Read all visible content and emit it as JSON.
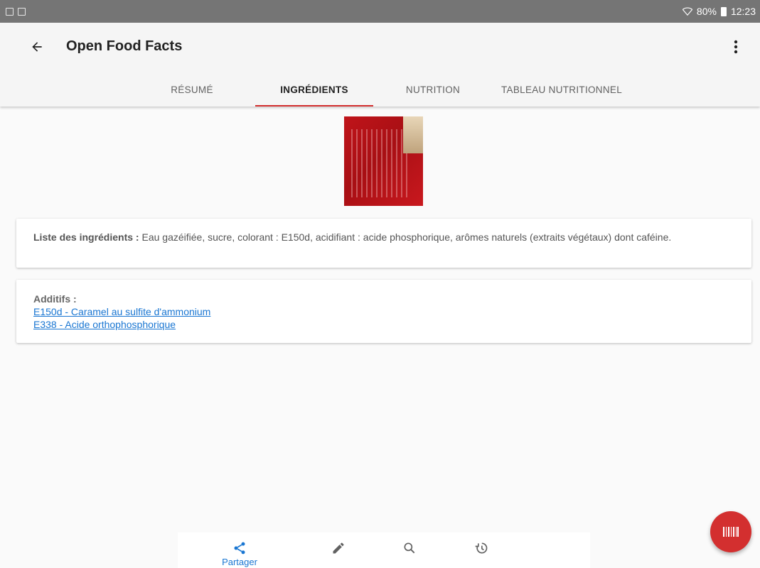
{
  "status_bar": {
    "battery": "80%",
    "time": "12:23"
  },
  "app_bar": {
    "title": "Open Food Facts",
    "back_icon": "arrow-back-icon",
    "menu_icon": "more-vert-icon"
  },
  "tabs": [
    {
      "label": "RÉSUMÉ",
      "active": false
    },
    {
      "label": "INGRÉDIENTS",
      "active": true
    },
    {
      "label": "NUTRITION",
      "active": false
    },
    {
      "label": "TABLEAU NUTRITIONNEL",
      "active": false
    }
  ],
  "ingredients": {
    "label": "Liste des ingrédients :",
    "text": " Eau gazéifiée, sucre, colorant : E150d, acidifiant : acide phosphorique, arômes naturels (extraits végétaux) dont caféine."
  },
  "additives": {
    "label": "Additifs :",
    "items": [
      "E150d - Caramel au sulfite d'ammonium",
      "E338 - Acide orthophosphorique"
    ]
  },
  "bottom_nav": {
    "share_label": "Partager",
    "items": [
      "share-icon",
      "edit-icon",
      "search-icon",
      "history-icon"
    ]
  },
  "fab": {
    "icon": "barcode-icon"
  },
  "colors": {
    "accent": "#d32f2f",
    "link": "#1976d2",
    "status_bar": "#757575"
  }
}
